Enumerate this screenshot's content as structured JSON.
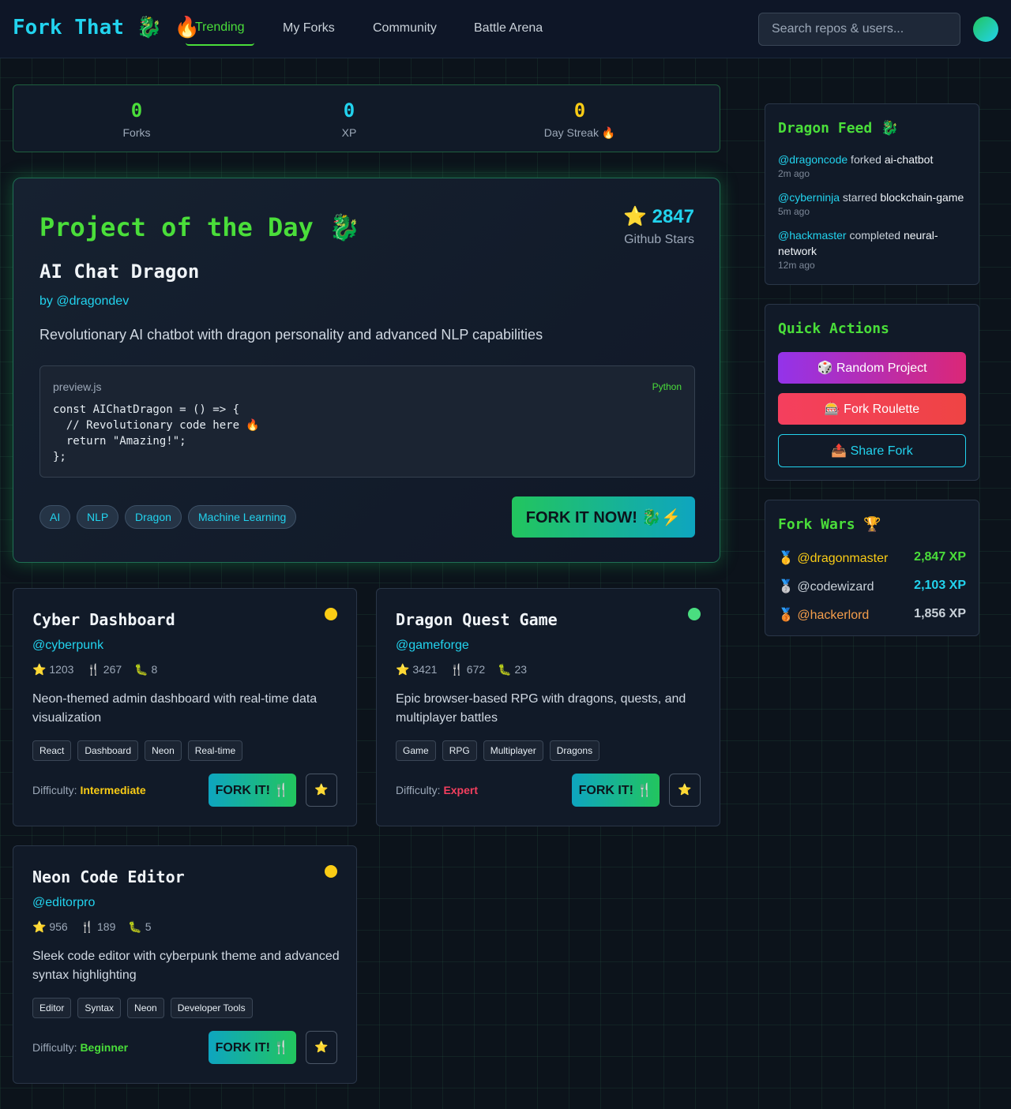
{
  "nav": {
    "logo": "Fork That 🐉 🔥",
    "links": [
      {
        "label": "Trending"
      },
      {
        "label": "My Forks"
      },
      {
        "label": "Community"
      },
      {
        "label": "Battle Arena"
      }
    ],
    "search_placeholder": "Search repos & users..."
  },
  "stats": [
    {
      "value": "0",
      "label": "Forks",
      "color": "#4ade3a"
    },
    {
      "value": "0",
      "label": "XP",
      "color": "#22d3ee"
    },
    {
      "value": "0",
      "label": "Day Streak 🔥",
      "color": "#facc15"
    }
  ],
  "featured": {
    "heading": "Project of the Day 🐉",
    "stars": "⭐ 2847",
    "stars_label": "Github Stars",
    "name": "AI Chat Dragon",
    "author": "by @dragondev",
    "description": "Revolutionary AI chatbot with dragon personality and advanced NLP capabilities",
    "code_file": "preview.js",
    "code_lang": "Python",
    "code": "const AIChatDragon = () => {\n  // Revolutionary code here 🔥\n  return \"Amazing!\";\n};",
    "tags": [
      "AI",
      "NLP",
      "Dragon",
      "Machine Learning"
    ],
    "button": "FORK IT NOW! 🐉⚡"
  },
  "cards": [
    {
      "title": "Cyber Dashboard",
      "author": "@cyberpunk",
      "stars": "⭐ 1203",
      "forks": "🍴 267",
      "issues": "🐛 8",
      "description": "Neon-themed admin dashboard with real-time data visualization",
      "tags": [
        "React",
        "Dashboard",
        "Neon",
        "Real-time"
      ],
      "difficulty_label": "Difficulty:",
      "difficulty": "Intermediate",
      "difficulty_color": "#facc15",
      "dot_color": "#facc15",
      "fork_label": "FORK IT! 🍴",
      "star_label": "⭐"
    },
    {
      "title": "Dragon Quest Game",
      "author": "@gameforge",
      "stars": "⭐ 3421",
      "forks": "🍴 672",
      "issues": "🐛 23",
      "description": "Epic browser-based RPG with dragons, quests, and multiplayer battles",
      "tags": [
        "Game",
        "RPG",
        "Multiplayer",
        "Dragons"
      ],
      "difficulty_label": "Difficulty:",
      "difficulty": "Expert",
      "difficulty_color": "#f43f5e",
      "dot_color": "#4ade80",
      "fork_label": "FORK IT! 🍴",
      "star_label": "⭐"
    },
    {
      "title": "Neon Code Editor",
      "author": "@editorpro",
      "stars": "⭐ 956",
      "forks": "🍴 189",
      "issues": "🐛 5",
      "description": "Sleek code editor with cyberpunk theme and advanced syntax highlighting",
      "tags": [
        "Editor",
        "Syntax",
        "Neon",
        "Developer Tools"
      ],
      "difficulty_label": "Difficulty:",
      "difficulty": "Beginner",
      "difficulty_color": "#4ade3a",
      "dot_color": "#facc15",
      "fork_label": "FORK IT! 🍴",
      "star_label": "⭐"
    }
  ],
  "feed": {
    "title": "Dragon Feed 🐉",
    "items": [
      {
        "user": "@dragoncode",
        "action": " forked ",
        "repo": "ai-chatbot",
        "time": "2m ago"
      },
      {
        "user": "@cyberninja",
        "action": " starred ",
        "repo": "blockchain-game",
        "time": "5m ago"
      },
      {
        "user": "@hackmaster",
        "action": " completed ",
        "repo": "neural-network",
        "time": "12m ago"
      }
    ]
  },
  "quick_actions": {
    "title": "Quick Actions",
    "buttons": [
      {
        "label": "🎲 Random Project"
      },
      {
        "label": "🎰 Fork Roulette"
      },
      {
        "label": "📤 Share Fork"
      }
    ]
  },
  "fork_wars": {
    "title": "Fork Wars 🏆",
    "entries": [
      {
        "name": "🥇 @dragonmaster",
        "xp": "2,847 XP",
        "name_color": "#facc15",
        "xp_color": "#4ade3a"
      },
      {
        "name": "🥈 @codewizard",
        "xp": "2,103 XP",
        "name_color": "#c9d1d9",
        "xp_color": "#22d3ee"
      },
      {
        "name": "🥉 @hackerlord",
        "xp": "1,856 XP",
        "name_color": "#f59e4b",
        "xp_color": "#c9d1d9"
      }
    ]
  }
}
